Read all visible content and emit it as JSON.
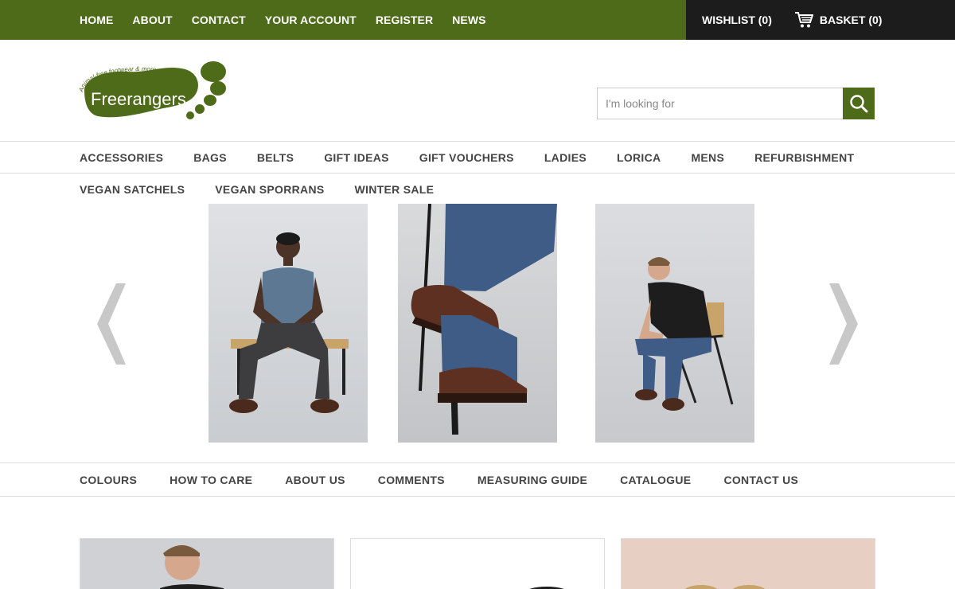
{
  "top_nav": {
    "items": [
      "HOME",
      "ABOUT",
      "CONTACT",
      "YOUR ACCOUNT",
      "REGISTER",
      "NEWS"
    ],
    "wishlist": "WISHLIST (0)",
    "basket": "BASKET (0)"
  },
  "header": {
    "logo_name": "Freerangers",
    "logo_tagline": "Animal-free footwear & more",
    "search_placeholder": "I'm looking for",
    "search_icon": "search-icon"
  },
  "category_nav": {
    "row1": [
      "ACCESSORIES",
      "BAGS",
      "BELTS",
      "GIFT IDEAS",
      "GIFT VOUCHERS",
      "LADIES",
      "LORICA",
      "MENS",
      "REFURBISHMENT"
    ],
    "row2": [
      "VEGAN SATCHELS",
      "VEGAN SPORRANS",
      "WINTER SALE"
    ]
  },
  "slider": {
    "prev_icon": "chevron-left-icon",
    "next_icon": "chevron-right-icon"
  },
  "info_nav": {
    "items": [
      "COLOURS",
      "HOW TO CARE",
      "ABOUT US",
      "COMMENTS",
      "MEASURING GUIDE",
      "CATALOGUE",
      "CONTACT US"
    ]
  },
  "colors": {
    "brand_green": "#4e6b1a",
    "dark_bar": "#1c1c1c",
    "arrow_grey": "#c8c8c8"
  }
}
